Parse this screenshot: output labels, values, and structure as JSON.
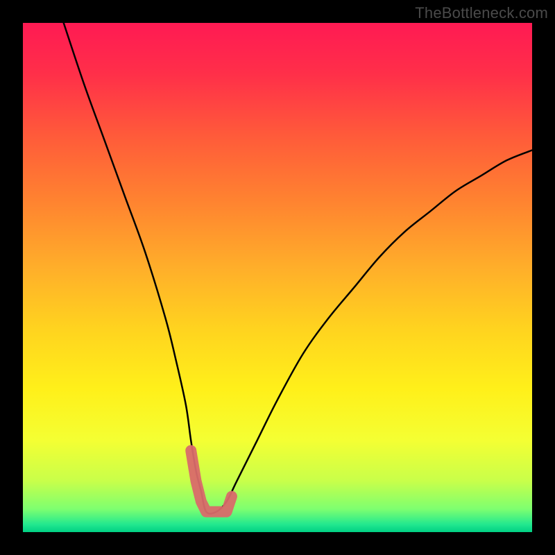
{
  "watermark": "TheBottleneck.com",
  "chart_data": {
    "type": "line",
    "title": "",
    "xlabel": "",
    "ylabel": "",
    "xlim": [
      0,
      100
    ],
    "ylim": [
      0,
      100
    ],
    "grid": false,
    "notes": "No axes or tick labels are rendered. Values are estimated normalized percentages (0–100 on each axis). The curve is a V-shaped bottleneck plot with its minimum near x≈36, y≈4. A short pink overlay segment sits at the trough.",
    "series": [
      {
        "name": "bottleneck-curve",
        "color": "#000000",
        "x": [
          8,
          12,
          16,
          20,
          24,
          28,
          30,
          32,
          33,
          34,
          35,
          36,
          38,
          40,
          42,
          46,
          50,
          55,
          60,
          65,
          70,
          75,
          80,
          85,
          90,
          95,
          100
        ],
        "y": [
          100,
          88,
          77,
          66,
          55,
          42,
          34,
          25,
          18,
          12,
          8,
          4,
          4,
          6,
          10,
          18,
          26,
          35,
          42,
          48,
          54,
          59,
          63,
          67,
          70,
          73,
          75
        ]
      },
      {
        "name": "highlight-segment",
        "color": "#d96a6a",
        "x": [
          33,
          34,
          35,
          36,
          38,
          40,
          41
        ],
        "y": [
          16,
          10,
          6,
          4,
          4,
          4,
          7
        ]
      }
    ],
    "gradient_stops": [
      {
        "offset": 0.0,
        "color": "#ff1a53"
      },
      {
        "offset": 0.1,
        "color": "#ff2f49"
      },
      {
        "offset": 0.22,
        "color": "#ff5a3a"
      },
      {
        "offset": 0.35,
        "color": "#ff8330"
      },
      {
        "offset": 0.48,
        "color": "#ffae2a"
      },
      {
        "offset": 0.6,
        "color": "#ffd31f"
      },
      {
        "offset": 0.72,
        "color": "#fff01a"
      },
      {
        "offset": 0.82,
        "color": "#f4ff33"
      },
      {
        "offset": 0.9,
        "color": "#c8ff4a"
      },
      {
        "offset": 0.955,
        "color": "#7dff70"
      },
      {
        "offset": 0.985,
        "color": "#22e88f"
      },
      {
        "offset": 1.0,
        "color": "#00d084"
      }
    ]
  }
}
